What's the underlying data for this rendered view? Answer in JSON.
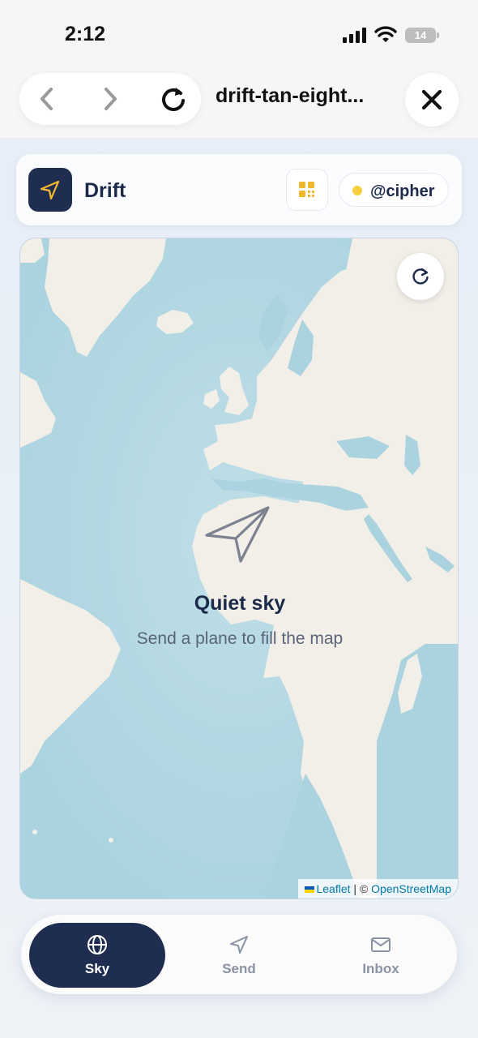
{
  "status_bar": {
    "time": "2:12",
    "battery": "14"
  },
  "browser": {
    "url": "drift-tan-eight...",
    "back_icon": "chevron-left-icon",
    "forward_icon": "chevron-right-icon",
    "reload_icon": "reload-icon",
    "close_icon": "close-icon"
  },
  "header": {
    "app_name": "Drift",
    "logo_icon": "paper-plane-icon",
    "grid_icon": "grid-icon",
    "username": "@cipher",
    "status_color": "#f5cf3d"
  },
  "map": {
    "empty_title": "Quiet sky",
    "empty_subtitle": "Send a plane to fill the map",
    "attribution_leaflet": "Leaflet",
    "attribution_separator": " | © ",
    "attribution_osm": "OpenStreetMap",
    "refresh_icon": "refresh-icon",
    "water_color": "#aad3df",
    "land_color": "#f2efe9"
  },
  "bottom_nav": {
    "tabs": [
      {
        "label": "Sky",
        "icon": "globe-icon",
        "active": true
      },
      {
        "label": "Send",
        "icon": "send-icon",
        "active": false
      },
      {
        "label": "Inbox",
        "icon": "mail-icon",
        "active": false
      }
    ]
  },
  "colors": {
    "navy": "#1e2d50",
    "accent_yellow": "#f5b82e"
  }
}
